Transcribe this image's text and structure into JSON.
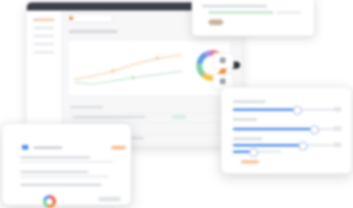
{
  "dashboard": {
    "chart_colors": [
      "#ef5d55",
      "#f08a3a",
      "#f6c244",
      "#7fcfa4",
      "#5b9be6",
      "#b48ee8"
    ],
    "accent": "#f08a3a"
  },
  "slider_panel": {
    "sliders": [
      {
        "fill": 0.6
      },
      {
        "fill": 0.76
      },
      {
        "fill": 0.65
      },
      {
        "fill": 0.4
      }
    ],
    "accent": "#4f8ff0"
  },
  "bottom_card": {
    "accent": "#4f8ff0"
  }
}
